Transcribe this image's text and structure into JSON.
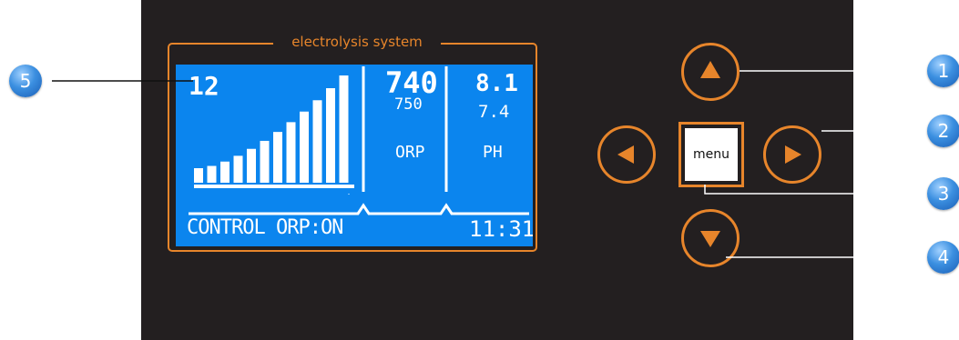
{
  "frame": {
    "title": "electrolysis system"
  },
  "lcd": {
    "level": "12",
    "orp_value": "740",
    "orp_setpoint": "750",
    "orp_label": "ORP",
    "ph_value": "8.1",
    "ph_setpoint": "7.4",
    "ph_label": "PH",
    "status": "CONTROL ORP:ON",
    "time": "11:31",
    "bar_count": 12
  },
  "buttons": {
    "up_icon": "triangle-up-icon",
    "left_icon": "triangle-left-icon",
    "right_icon": "triangle-right-icon",
    "down_icon": "triangle-down-icon",
    "menu_label": "menu"
  },
  "callouts": [
    "1",
    "2",
    "3",
    "4",
    "5"
  ],
  "colors": {
    "panel": "#231f20",
    "accent": "#e7852b",
    "lcd": "#0b85ee",
    "callout": "#3b8fe0"
  }
}
